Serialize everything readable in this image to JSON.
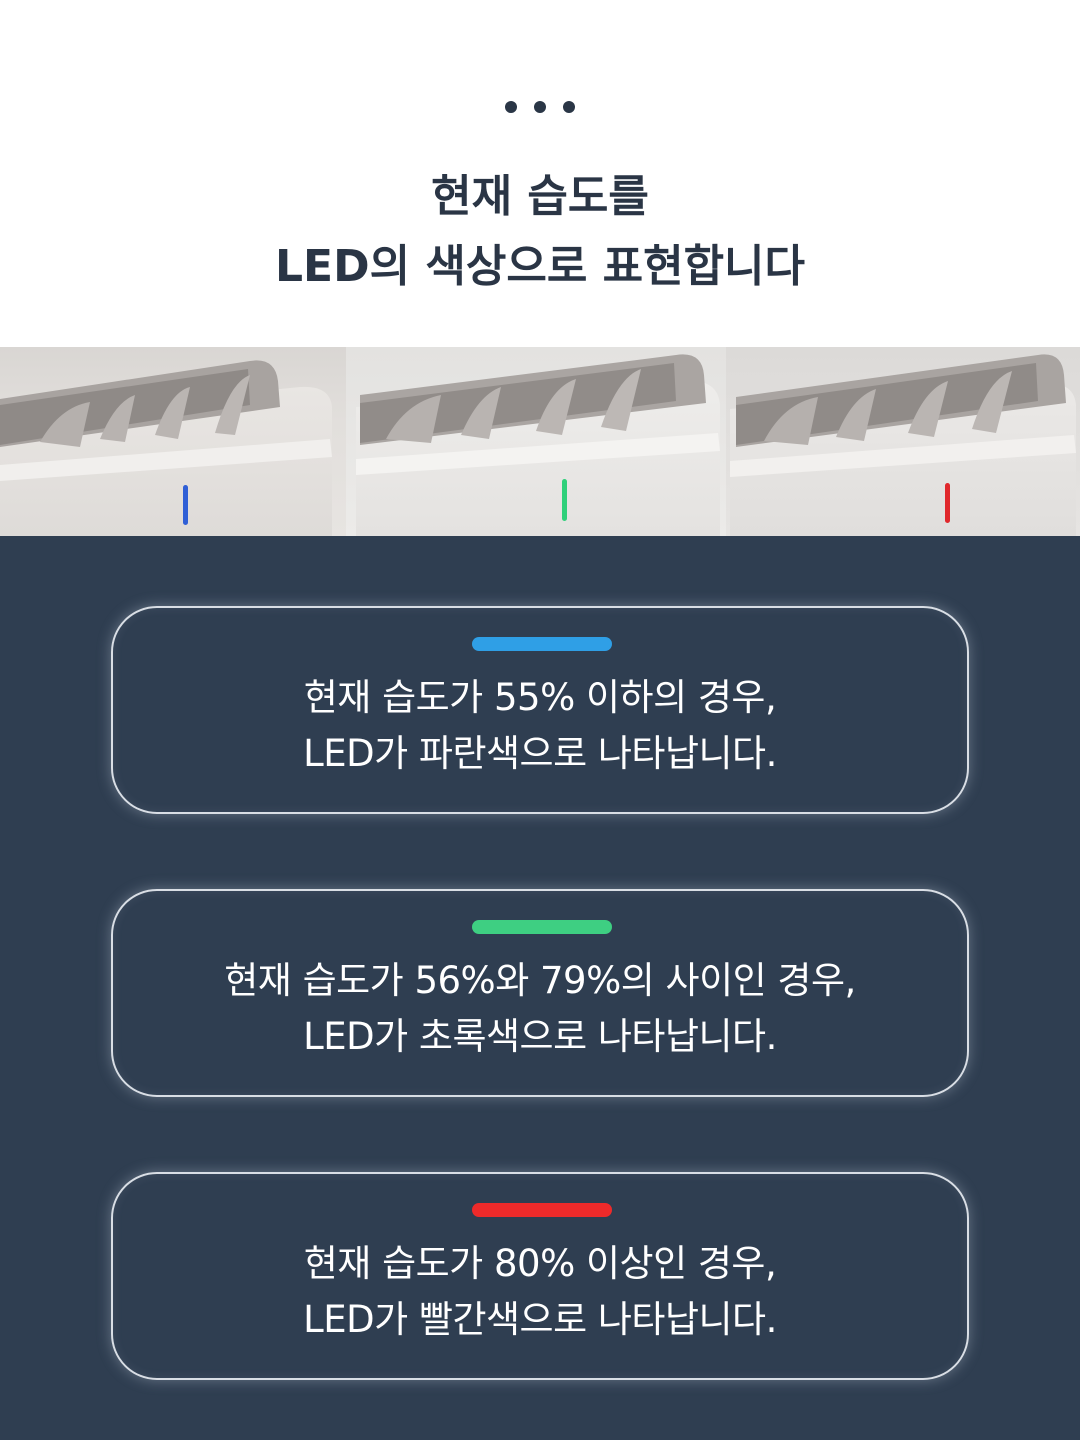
{
  "header": {
    "dots_icon": "ellipsis-icon",
    "title_line1": "현재 습도를",
    "title_line2": "LED의 색상으로 표현합니다"
  },
  "photos": {
    "panels": [
      {
        "led_color": "#2f5fd6"
      },
      {
        "led_color": "#2fd07a"
      },
      {
        "led_color": "#e0282c"
      }
    ]
  },
  "cards": [
    {
      "bar_color": "#2f9fe6",
      "line1": "현재 습도가 55% 이하의 경우,",
      "line2": "LED가 파란색으로 나타납니다."
    },
    {
      "bar_color": "#3ecf82",
      "line1": "현재 습도가 56%와 79%의 사이인 경우,",
      "line2": "LED가 초록색으로 나타납니다."
    },
    {
      "bar_color": "#ee2a2a",
      "line1": "현재 습도가 80% 이상인 경우,",
      "line2": "LED가 빨간색으로 나타납니다."
    }
  ],
  "colors": {
    "dark_background": "#2f3e51",
    "title_text": "#2a3545"
  }
}
